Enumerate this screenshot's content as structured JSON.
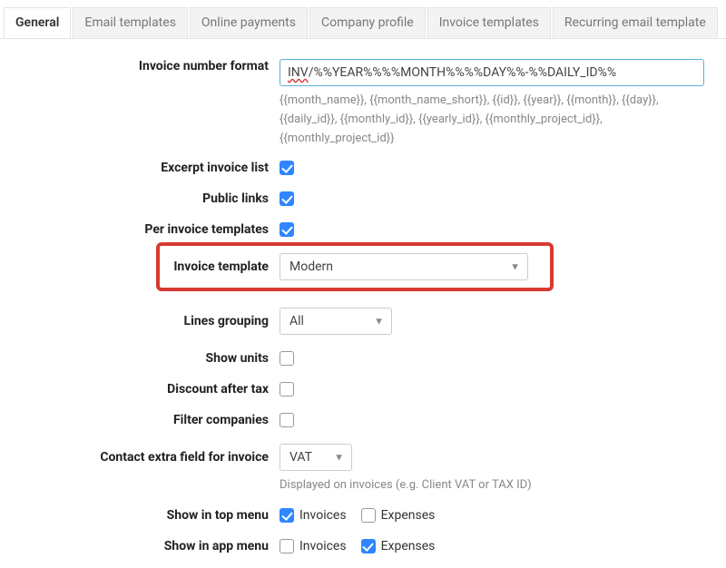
{
  "tabs": {
    "general": "General",
    "email_templates": "Email templates",
    "online_payments": "Online payments",
    "company_profile": "Company profile",
    "invoice_templates": "Invoice templates",
    "recurring_email": "Recurring email template"
  },
  "invoice_number_format": {
    "label": "Invoice number format",
    "value_prefix": "INV",
    "value_rest": "/%%YEAR%%%%MONTH%%%%DAY%%-%%DAILY_ID%%",
    "hint": "{{month_name}}, {{month_name_short}}, {{id}}, {{year}}, {{month}}, {{day}}, {{daily_id}}, {{monthly_id}}, {{yearly_id}}, {{monthly_project_id}}, {{monthly_project_id}}"
  },
  "excerpt_invoice_list": {
    "label": "Excerpt invoice list",
    "checked": true
  },
  "public_links": {
    "label": "Public links",
    "checked": true
  },
  "per_invoice_templates": {
    "label": "Per invoice templates",
    "checked": true
  },
  "invoice_template": {
    "label": "Invoice template",
    "value": "Modern"
  },
  "lines_grouping": {
    "label": "Lines grouping",
    "value": "All"
  },
  "show_units": {
    "label": "Show units",
    "checked": false
  },
  "discount_after_tax": {
    "label": "Discount after tax",
    "checked": false
  },
  "filter_companies": {
    "label": "Filter companies",
    "checked": false
  },
  "contact_extra_field": {
    "label": "Contact extra field for invoice",
    "value": "VAT",
    "hint": "Displayed on invoices (e.g. Client VAT or TAX ID)"
  },
  "show_in_top_menu": {
    "label": "Show in top menu",
    "invoices": {
      "label": "Invoices",
      "checked": true
    },
    "expenses": {
      "label": "Expenses",
      "checked": false
    }
  },
  "show_in_app_menu": {
    "label": "Show in app menu",
    "invoices": {
      "label": "Invoices",
      "checked": false
    },
    "expenses": {
      "label": "Expenses",
      "checked": true
    }
  }
}
